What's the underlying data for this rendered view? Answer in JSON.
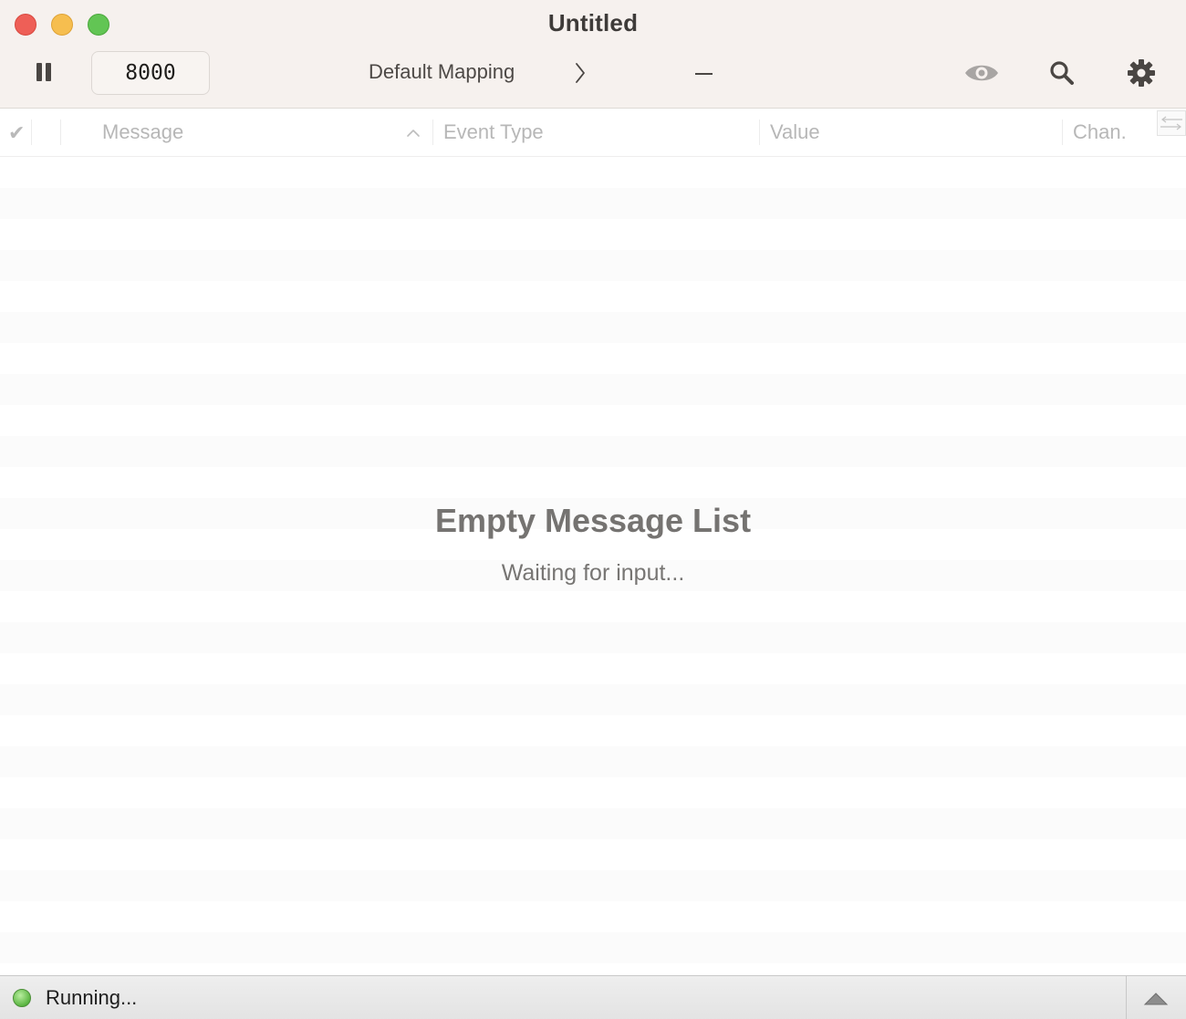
{
  "window": {
    "title": "Untitled"
  },
  "toolbar": {
    "port_value": "8000",
    "mapping_label": "Default Mapping",
    "pause_icon": "pause-icon",
    "chevron_icon": "chevron-right-icon",
    "minus_icon": "minus-icon",
    "eye_icon": "eye-icon",
    "search_icon": "search-icon",
    "gear_icon": "gear-icon"
  },
  "table": {
    "check_header": "✔",
    "columns": [
      "Message",
      "Event Type",
      "Value",
      "Chan."
    ],
    "sort_icon": "sort-ascending-icon",
    "column_options_icon": "column-resize-icon"
  },
  "empty_state": {
    "title": "Empty Message List",
    "subtitle": "Waiting for input..."
  },
  "status": {
    "text": "Running...",
    "indicator_color": "#5bbf44",
    "drawer_icon": "triangle-up-icon"
  },
  "colors": {
    "close": "#ee5f57",
    "minimize": "#f6be4f",
    "zoom": "#62c554",
    "toolbar_bg": "#f6f1ee"
  }
}
